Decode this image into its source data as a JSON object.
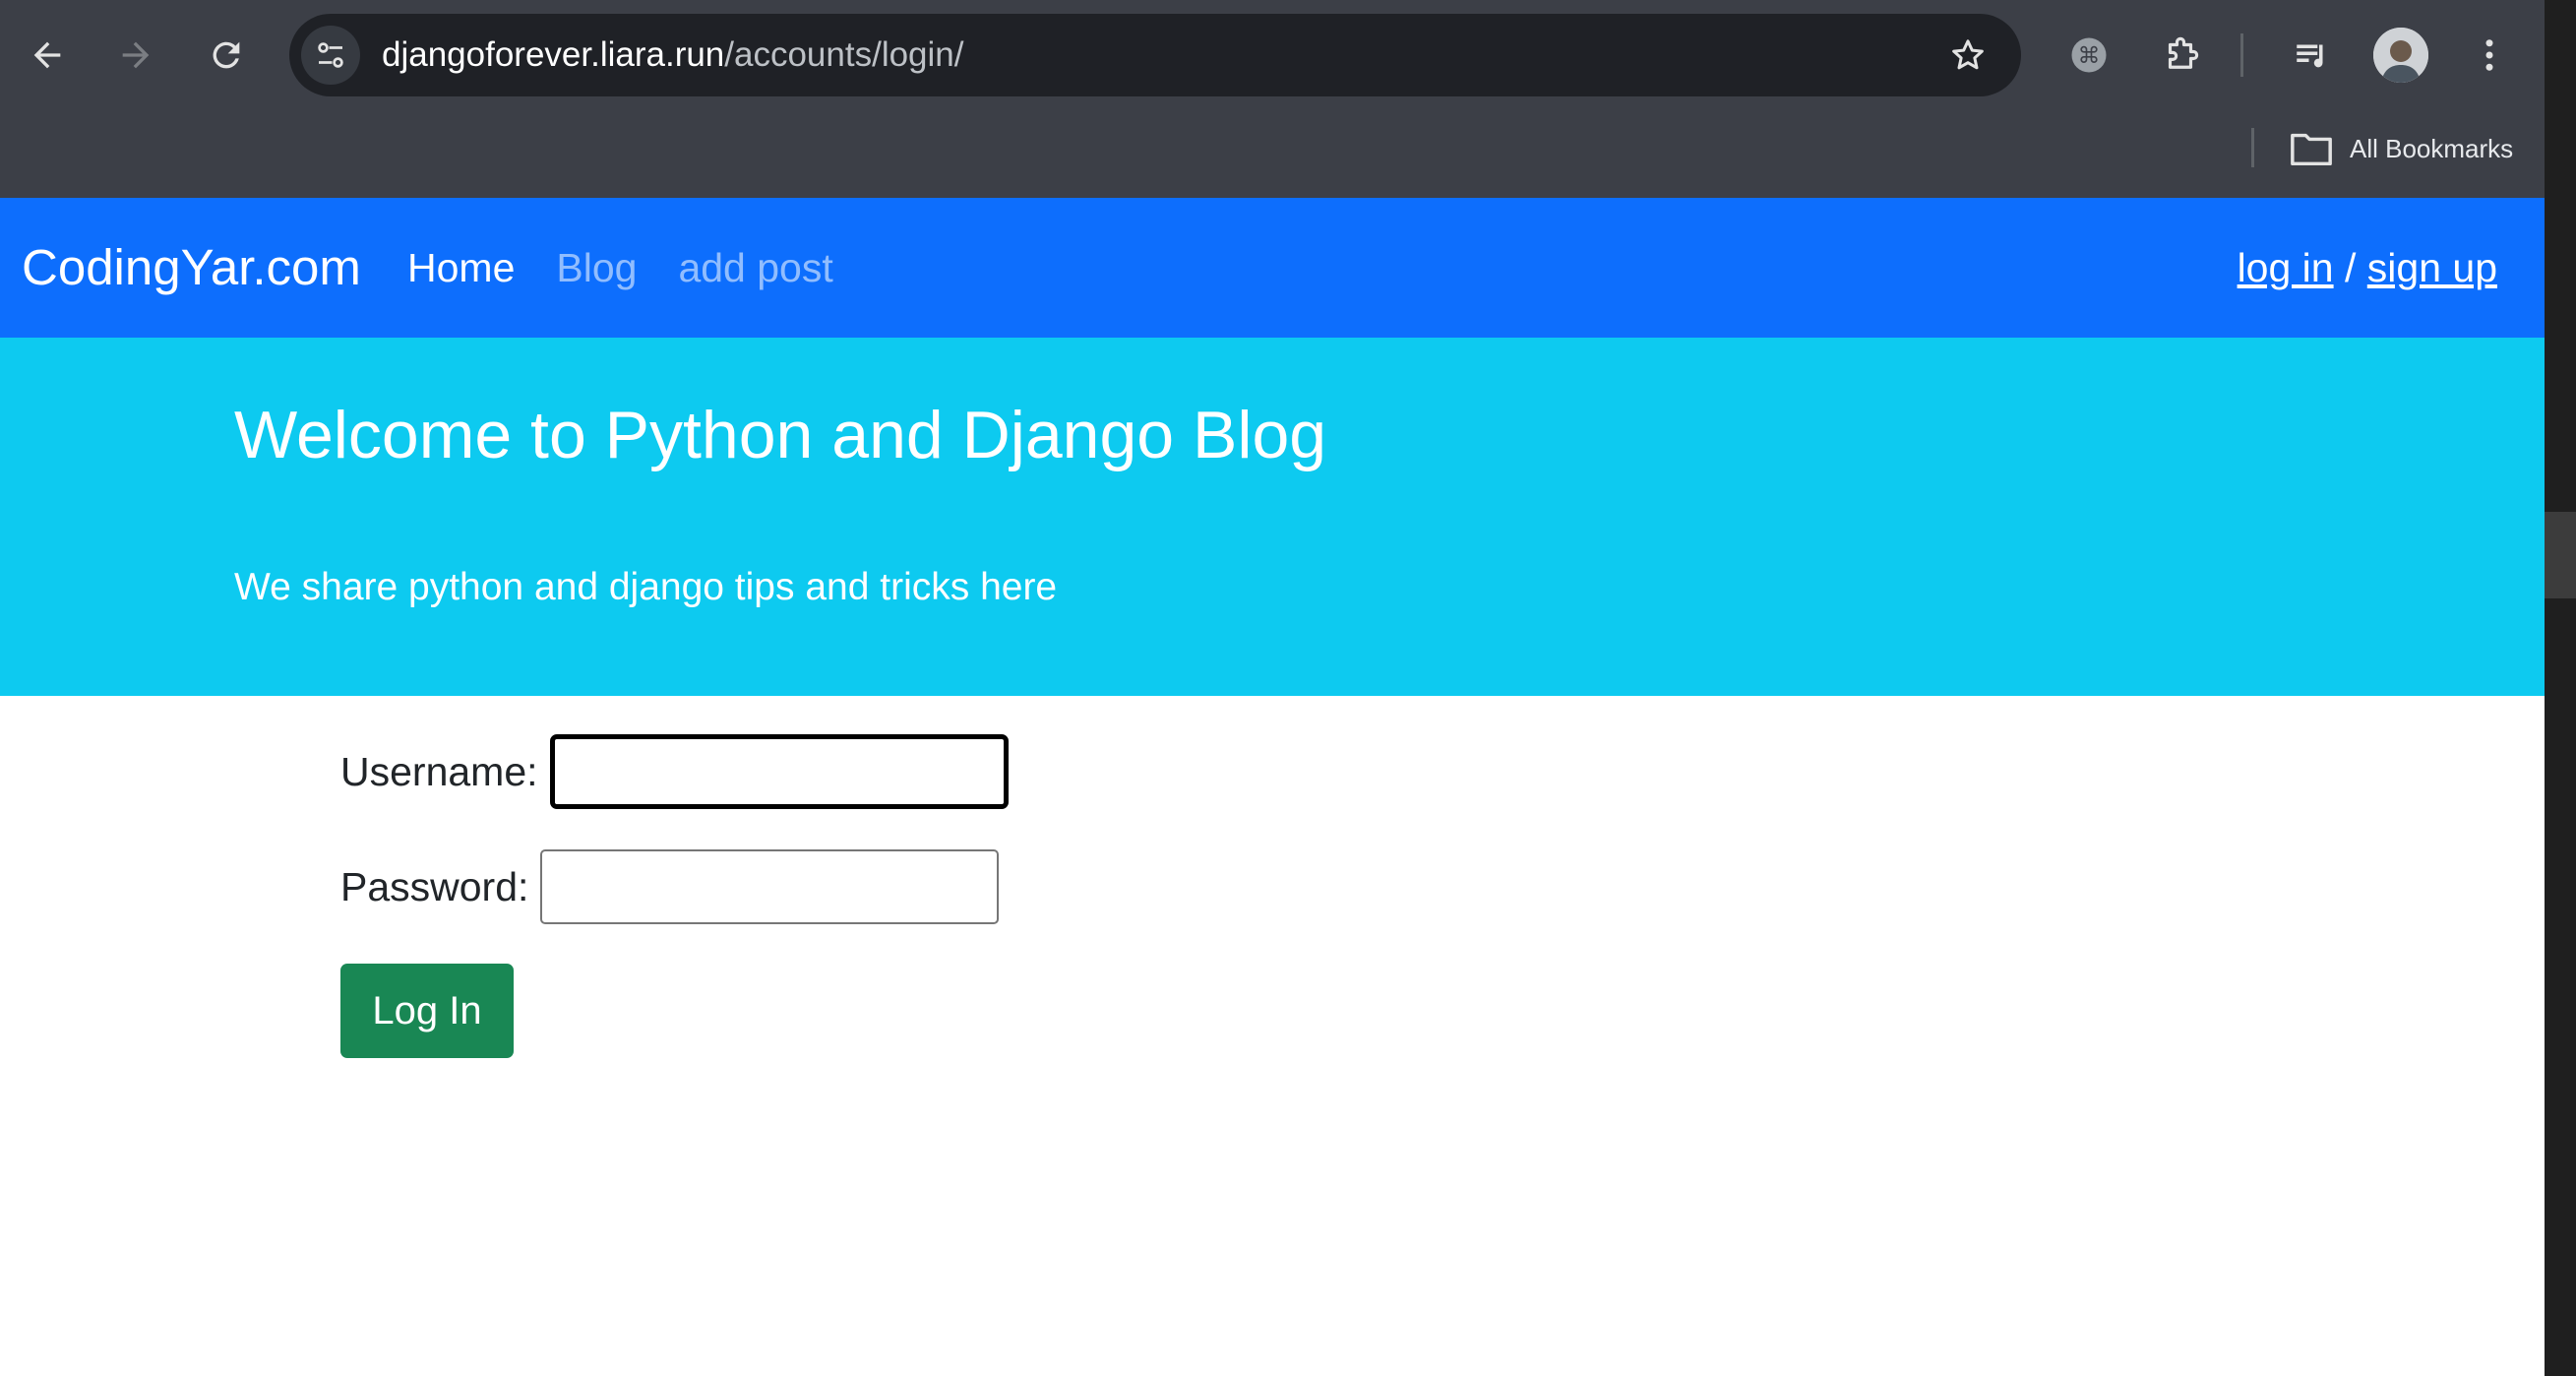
{
  "browser": {
    "url_host": "djangoforever.liara.run",
    "url_path": "/accounts/login/",
    "bookmarks_label": "All Bookmarks"
  },
  "icons": {
    "back": "back-arrow-icon",
    "forward": "forward-arrow-icon",
    "reload": "reload-icon",
    "site_info": "tune-icon",
    "bookmark": "star-icon",
    "extension_1": "command-icon",
    "extensions": "puzzle-icon",
    "media": "media-queue-icon",
    "menu": "kebab-menu-icon",
    "folder": "folder-icon"
  },
  "site": {
    "brand": "CodingYar.com",
    "nav": [
      {
        "label": "Home",
        "active": true
      },
      {
        "label": "Blog",
        "active": false
      },
      {
        "label": "add post",
        "active": false
      }
    ],
    "auth": {
      "login": "log in",
      "separator": " / ",
      "signup": "sign up"
    }
  },
  "hero": {
    "title": "Welcome to Python and Django Blog",
    "lead": "We share python and django tips and tricks here"
  },
  "login_form": {
    "username_label": "Username:",
    "username_value": "",
    "password_label": "Password:",
    "password_value": "",
    "submit_label": "Log In"
  },
  "colors": {
    "navbar": "#0d6efd",
    "hero": "#0dcaf0",
    "submit": "#198754",
    "chrome": "#3c3f47"
  }
}
